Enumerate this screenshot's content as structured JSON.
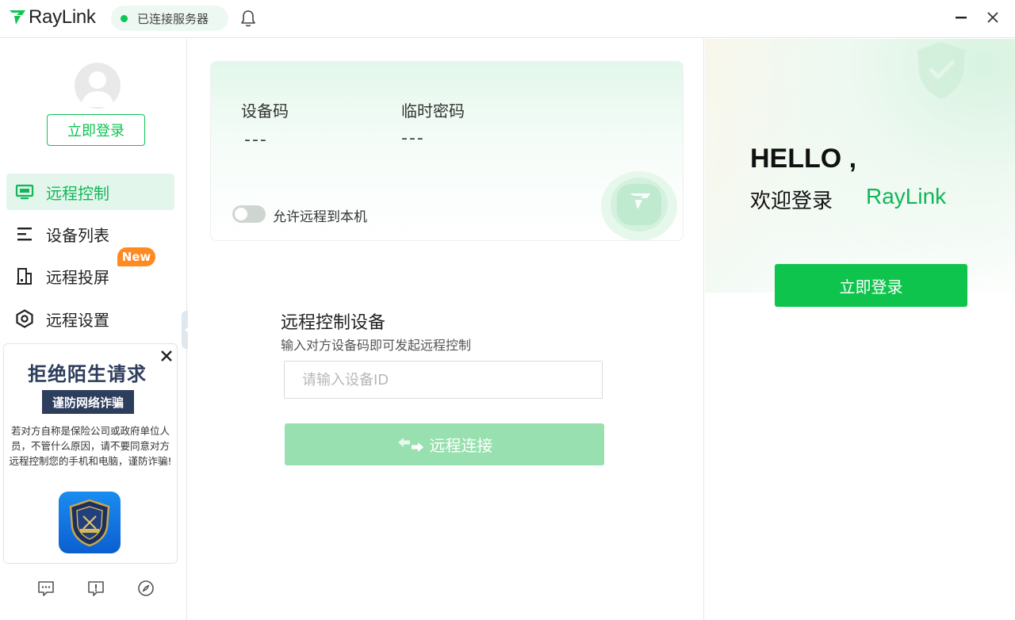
{
  "app": {
    "brand": "RayLink",
    "status": "已连接服务器"
  },
  "sidebar": {
    "login_label": "立即登录",
    "items": [
      {
        "label": "远程控制",
        "icon": "monitor-icon",
        "active": true
      },
      {
        "label": "设备列表",
        "icon": "list-icon",
        "active": false
      },
      {
        "label": "远程投屏",
        "icon": "cast-screen-icon",
        "active": false
      },
      {
        "label": "远程设置",
        "icon": "settings-hex-icon",
        "active": false
      }
    ],
    "new_badge": "New",
    "ad": {
      "title": "拒绝陌生请求",
      "subtitle": "谨防网络诈骗",
      "body": "若对方自称是保险公司或政府单位人员，不管什么原因，请不要同意对方远程控制您的手机和电脑，谨防诈骗!"
    },
    "bottom_icons": [
      "chat-icon",
      "feedback-icon",
      "compass-icon"
    ]
  },
  "device_card": {
    "device_code_label": "设备码",
    "device_code_value": "---",
    "temp_password_label": "临时密码",
    "temp_password_value": "---",
    "allow_remote_label": "允许远程到本机",
    "allow_remote_enabled": false
  },
  "remote_control": {
    "title": "远程控制设备",
    "subtitle": "输入对方设备码即可发起远程控制",
    "input_placeholder": "请输入设备ID",
    "connect_label": "远程连接"
  },
  "right_panel": {
    "hello": "HELLO ,",
    "welcome": "欢迎登录",
    "brand": "RayLink",
    "login_label": "立即登录"
  },
  "colors": {
    "accent": "#0fc455",
    "accent_dark": "#10b757",
    "connect_disabled": "#98e0af",
    "badge": "#ff8a1f"
  }
}
